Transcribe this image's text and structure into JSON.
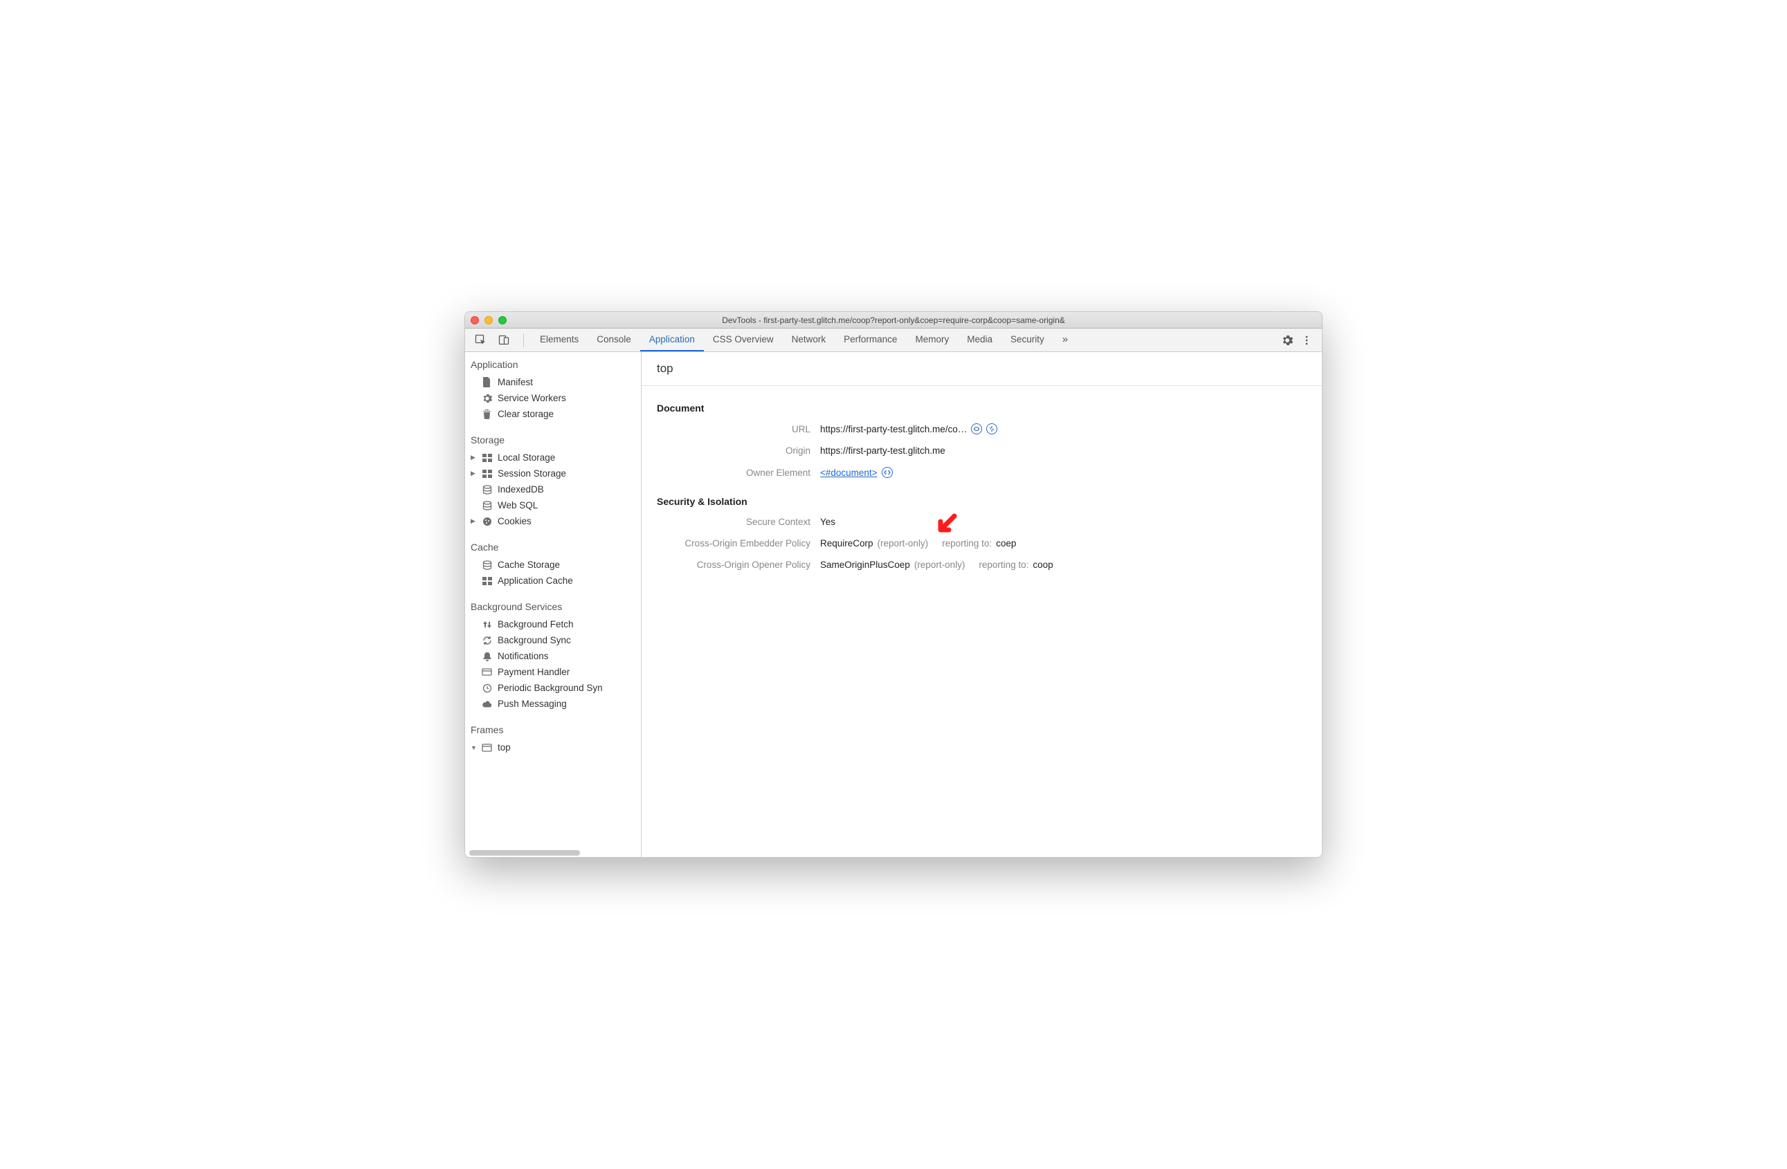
{
  "window": {
    "title": "DevTools - first-party-test.glitch.me/coop?report-only&coep=require-corp&coop=same-origin&"
  },
  "tabs": {
    "items": [
      "Elements",
      "Console",
      "Application",
      "CSS Overview",
      "Network",
      "Performance",
      "Memory",
      "Media",
      "Security"
    ],
    "active_index": 2,
    "overflow_icon": "»"
  },
  "sidebar": {
    "groups": [
      {
        "title": "Application",
        "items": [
          {
            "icon": "file-icon",
            "label": "Manifest",
            "expandable": false
          },
          {
            "icon": "gear-icon",
            "label": "Service Workers",
            "expandable": false
          },
          {
            "icon": "trash-icon",
            "label": "Clear storage",
            "expandable": false
          }
        ]
      },
      {
        "title": "Storage",
        "items": [
          {
            "icon": "grid-icon",
            "label": "Local Storage",
            "expandable": true
          },
          {
            "icon": "grid-icon",
            "label": "Session Storage",
            "expandable": true
          },
          {
            "icon": "database-icon",
            "label": "IndexedDB",
            "expandable": false
          },
          {
            "icon": "database-icon",
            "label": "Web SQL",
            "expandable": false
          },
          {
            "icon": "cookie-icon",
            "label": "Cookies",
            "expandable": true
          }
        ]
      },
      {
        "title": "Cache",
        "items": [
          {
            "icon": "database-icon",
            "label": "Cache Storage",
            "expandable": false
          },
          {
            "icon": "grid-icon",
            "label": "Application Cache",
            "expandable": false
          }
        ]
      },
      {
        "title": "Background Services",
        "items": [
          {
            "icon": "updown-icon",
            "label": "Background Fetch",
            "expandable": false
          },
          {
            "icon": "sync-icon",
            "label": "Background Sync",
            "expandable": false
          },
          {
            "icon": "bell-icon",
            "label": "Notifications",
            "expandable": false
          },
          {
            "icon": "card-icon",
            "label": "Payment Handler",
            "expandable": false
          },
          {
            "icon": "clock-icon",
            "label": "Periodic Background Syn",
            "expandable": false
          },
          {
            "icon": "cloud-icon",
            "label": "Push Messaging",
            "expandable": false
          }
        ]
      },
      {
        "title": "Frames",
        "items": [
          {
            "icon": "frame-icon",
            "label": "top",
            "expandable": true,
            "open": true,
            "selected": true
          }
        ]
      }
    ]
  },
  "main": {
    "heading": "top",
    "sections": [
      {
        "title": "Document",
        "fields": [
          {
            "label": "URL",
            "value": "https://first-party-test.glitch.me/co…",
            "badges": [
              "ellipse-icon",
              "reload-icon"
            ]
          },
          {
            "label": "Origin",
            "value": "https://first-party-test.glitch.me"
          },
          {
            "label": "Owner Element",
            "link": "<#document>",
            "code_icon": true
          }
        ]
      },
      {
        "title": "Security & Isolation",
        "fields": [
          {
            "label": "Secure Context",
            "value": "Yes"
          },
          {
            "label": "Cross-Origin Embedder Policy",
            "value": "RequireCorp",
            "suffix_muted": "(report-only)",
            "reporting_to": "coep",
            "arrow": true
          },
          {
            "label": "Cross-Origin Opener Policy",
            "value": "SameOriginPlusCoep",
            "suffix_muted": "(report-only)",
            "reporting_to": "coop"
          }
        ]
      }
    ],
    "reporting_label": "reporting to:"
  }
}
